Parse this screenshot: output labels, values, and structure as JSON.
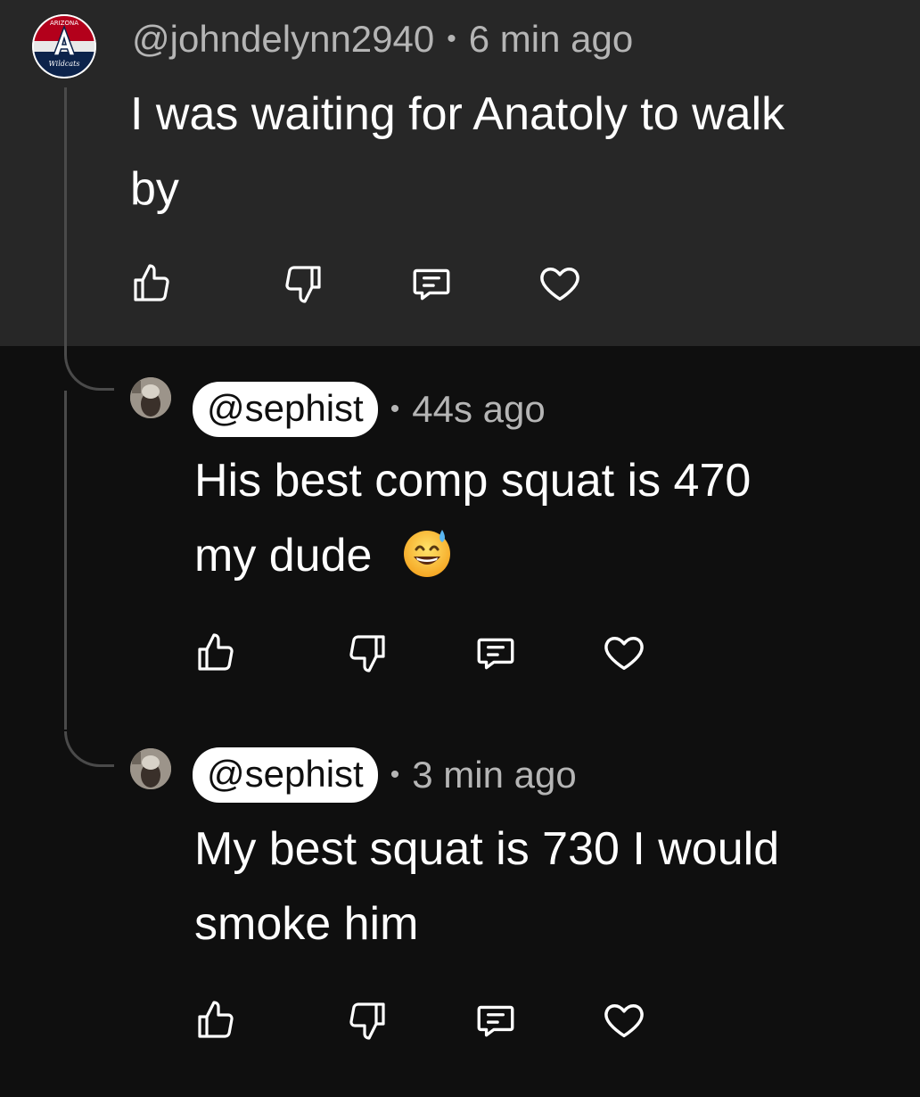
{
  "parent": {
    "handle": "@johndelynn2940",
    "time": "6 min ago",
    "text_line1": "I was waiting for Anatoly to walk",
    "text_line2": "by",
    "avatar": {
      "name": "arizona-wildcats-logo",
      "letter": "A",
      "top_text": "ARIZONA",
      "bottom_text": "Wildcats"
    }
  },
  "replies": [
    {
      "handle": "@sephist",
      "time": "44s ago",
      "text_line1": "His best comp squat is 470",
      "text_line2": "my dude",
      "emoji": "grinning-face-with-sweat"
    },
    {
      "handle": "@sephist",
      "time": "3 min ago",
      "text_line1": "My best squat is 730 I would",
      "text_line2": "smoke him"
    }
  ],
  "separator": "•",
  "actions": [
    "thumbs-up-icon",
    "thumbs-down-icon",
    "reply-icon",
    "heart-icon"
  ],
  "colors": {
    "background": "#0f0f0f",
    "parent_background": "#272727",
    "text": "#ffffff",
    "meta": "#b5b5b5",
    "pill": "#ffffff"
  }
}
